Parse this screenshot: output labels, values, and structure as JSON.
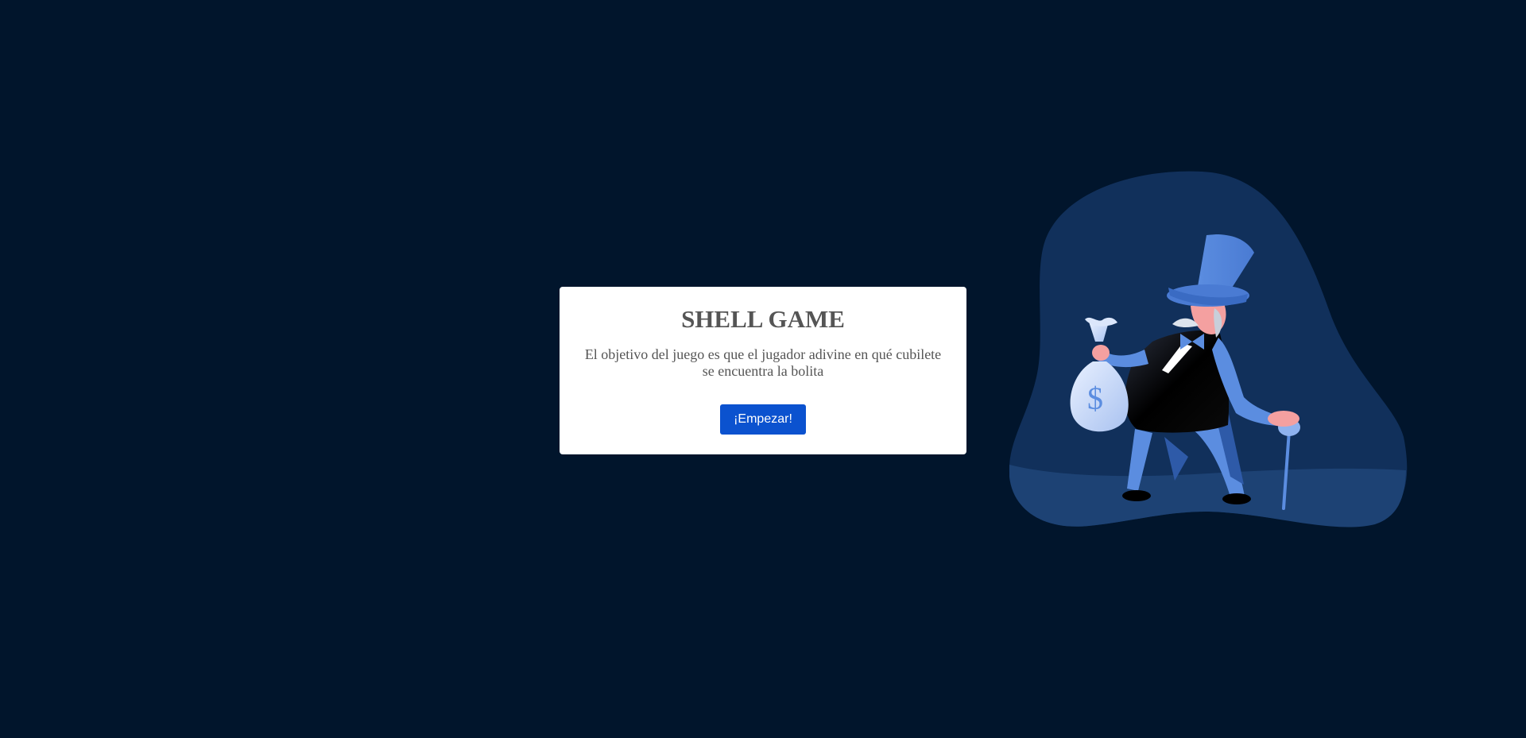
{
  "intro": {
    "title": "SHELL GAME",
    "description": "El objetivo del juego es que el jugador adivine en qué cubilete se encuentra la bolita",
    "start_label": "¡Empezar!"
  },
  "illustration": {
    "subject": "magnate-with-money-bag",
    "bag_symbol": "$"
  },
  "colors": {
    "background": "#01152c",
    "card": "#ffffff",
    "text": "#555555",
    "button": "#0b52cf",
    "blob_dark": "#11305b",
    "blob_light": "#1d4274",
    "figure_blue": "#5b8de0",
    "skin": "#f4a0a0"
  }
}
